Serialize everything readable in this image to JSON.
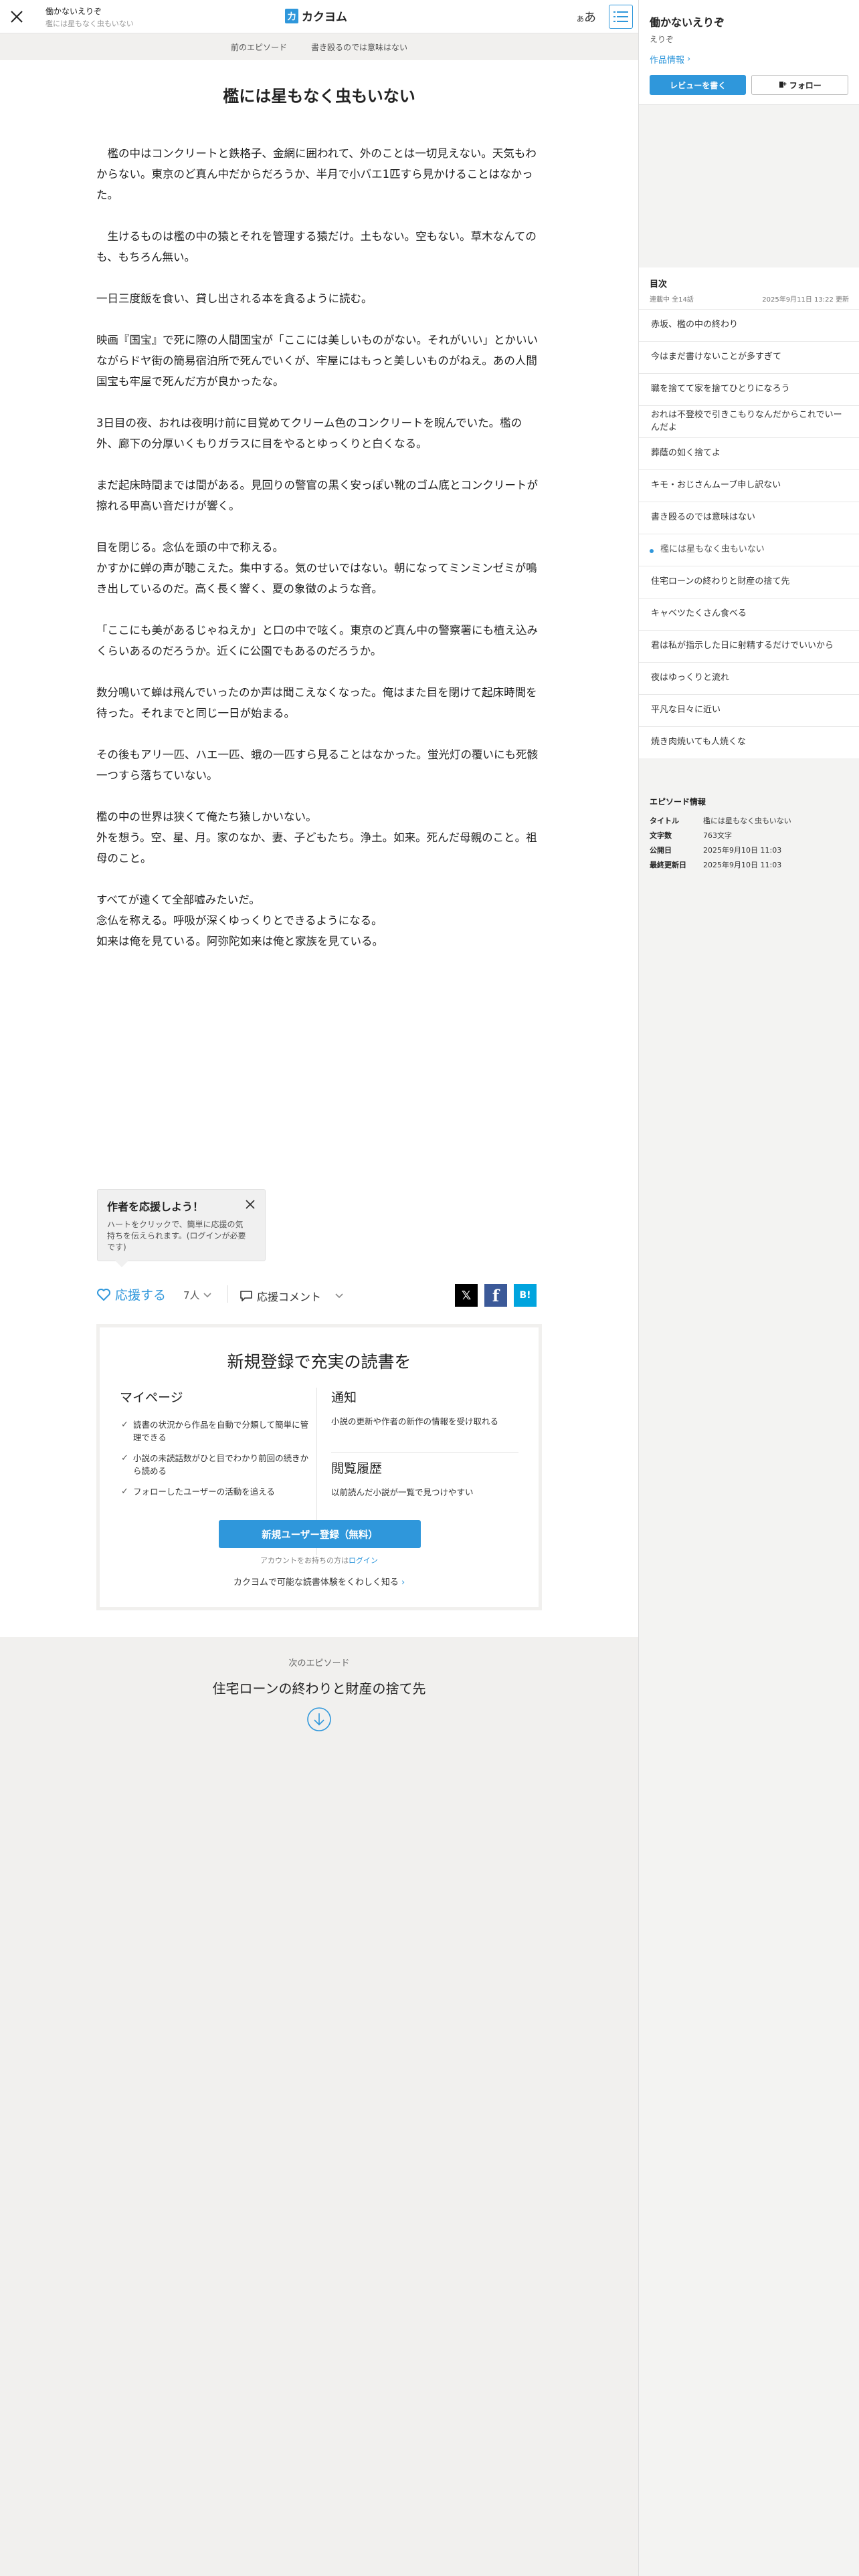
{
  "header": {
    "work_title": "働かないえりぞ",
    "episode_subtitle": "檻には星もなく虫もいない",
    "logo_mark": "力",
    "logo_text": "カクヨム",
    "font_small": "あ",
    "font_large": "あ"
  },
  "subbar": {
    "prev_label": "前のエピソード",
    "prev_title": "書き殴るのでは意味はない"
  },
  "episode": {
    "title": "檻には星もなく虫もいない",
    "paragraphs": [
      "　檻の中はコンクリートと鉄格子、金網に囲われて、外のことは一切見えない。天気もわからない。東京のど真ん中だからだろうか、半月で小バエ1匹すら見かけることはなかった。",
      "",
      "　生けるものは檻の中の猿とそれを管理する猿だけ。土もない。空もない。草木なんてのも、もちろん無い。",
      "",
      "一日三度飯を食い、貸し出される本を貪るように読む。",
      "",
      "映画『国宝』で死に際の人間国宝が「ここには美しいものがない。それがいい」とかいいながらドヤ街の簡易宿泊所で死んでいくが、牢屋にはもっと美しいものがねえ。あの人間国宝も牢屋で死んだ方が良かったな。",
      "",
      "3日目の夜、おれは夜明け前に目覚めてクリーム色のコンクリートを睨んでいた。檻の外、廊下の分厚いくもりガラスに目をやるとゆっくりと白くなる。",
      "",
      "まだ起床時間までは間がある。見回りの警官の黒く安っぽい靴のゴム底とコンクリートが擦れる甲高い音だけが響く。",
      "",
      "目を閉じる。念仏を頭の中で称える。",
      "かすかに蝉の声が聴こえた。集中する。気のせいではない。朝になってミンミンゼミが鳴き出しているのだ。高く長く響く、夏の象徴のような音。",
      "",
      "「ここにも美があるじゃねえか」と口の中で呟く。東京のど真ん中の警察署にも植え込みくらいあるのだろうか。近くに公園でもあるのだろうか。",
      "",
      "数分鳴いて蝉は飛んでいったのか声は聞こえなくなった。俺はまた目を閉けて起床時間を待った。それまでと同じ一日が始まる。",
      "",
      "その後もアリ一匹、ハエ一匹、蛾の一匹すら見ることはなかった。蛍光灯の覆いにも死骸一つすら落ちていない。",
      "",
      "檻の中の世界は狭くて俺たち猿しかいない。",
      "外を想う。空、星、月。家のなか、妻、子どもたち。浄土。如来。死んだ母親のこと。祖母のこと。",
      "",
      "すべてが遠くて全部嘘みたいだ。",
      "念仏を称える。呼吸が深くゆっくりとできるようになる。",
      "如来は俺を見ている。阿弥陀如来は俺と家族を見ている。"
    ]
  },
  "cheer_tip": {
    "title": "作者を応援しよう！",
    "body": "ハートをクリックで、簡単に応援の気持ちを伝えられます。(ログインが必要です)"
  },
  "actions": {
    "cheer_label": "応援する",
    "cheer_count": "7人",
    "comment_label": "応援コメント",
    "share_x": "𝕏",
    "share_fb": "f",
    "share_hb": "B!"
  },
  "signup": {
    "title": "新規登録で充実の読書を",
    "mypage_head": "マイページ",
    "mypage_items": [
      "読書の状況から作品を自動で分類して簡単に管理できる",
      "小説の未読話数がひと目でわかり前回の続きから読める",
      "フォローしたユーザーの活動を追える"
    ],
    "notice_head": "通知",
    "notice_text": "小説の更新や作者の新作の情報を受け取れる",
    "history_head": "閲覧履歴",
    "history_text": "以前読んだ小説が一覧で見つけやすい",
    "register_label": "新規ユーザー登録（無料）",
    "login_prefix": "アカウントをお持ちの方は",
    "login_link": "ログイン",
    "learn_more": "カクヨムで可能な読書体験をくわしく知る"
  },
  "next": {
    "label": "次のエピソード",
    "title": "住宅ローンの終わりと財産の捨て先"
  },
  "side": {
    "work_title": "働かないえりぞ",
    "author": "えりぞ",
    "info_link": "作品情報",
    "review_label": "レビューを書く",
    "follow_label": "フォロー",
    "toc_title": "目次",
    "toc_status": "連載中 全14話",
    "toc_updated": "2025年9月11日 13:22 更新",
    "episodes": [
      "赤坂、檻の中の終わり",
      "今はまだ書けないことが多すぎて",
      "職を捨てて家を捨てひとりになろう",
      "おれは不登校で引きこもりなんだからこれでいーんだよ",
      "葬蔭の如く捨てよ",
      "キモ・おじさんムーブ申し訳ない",
      "書き殴るのでは意味はない",
      "檻には星もなく虫もいない",
      "住宅ローンの終わりと財産の捨て先",
      "キャベツたくさん食べる",
      "君は私が指示した日に射精するだけでいいから",
      "夜はゆっくりと流れ",
      "平凡な日々に近い",
      "焼き肉焼いても人焼くな"
    ],
    "current_index": 7,
    "ep_info_title": "エピソード情報",
    "ep_info": {
      "title_key": "タイトル",
      "title_val": "檻には星もなく虫もいない",
      "chars_key": "文字数",
      "chars_val": "763文字",
      "pub_key": "公開日",
      "pub_val": "2025年9月10日 11:03",
      "upd_key": "最終更新日",
      "upd_val": "2025年9月10日 11:03"
    }
  },
  "colors": {
    "accent": "#2f97db",
    "background": "#f1f0ee",
    "text": "#222222"
  }
}
